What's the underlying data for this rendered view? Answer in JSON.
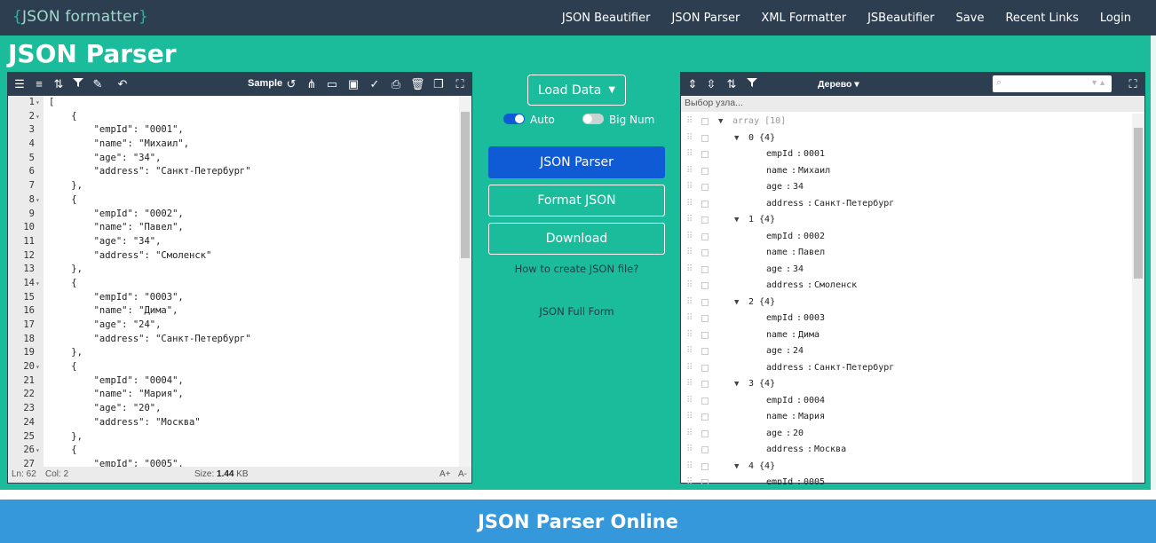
{
  "brand": {
    "open": "{",
    "name": "JSON formatter",
    "close": "}"
  },
  "nav": [
    "JSON Beautifier",
    "JSON Parser",
    "XML Formatter",
    "JSBeautifier",
    "Save",
    "Recent Links",
    "Login"
  ],
  "page_title": "JSON Parser",
  "editor": {
    "sample_label": "Sample",
    "status": {
      "line": "Ln: 62",
      "col": "Col: 2",
      "size_label": "Size:",
      "size_value": "1.44",
      "size_unit": "KB",
      "font_up": "A+",
      "font_down": "A-"
    },
    "lines": [
      {
        "n": "1",
        "fold": true,
        "text": "["
      },
      {
        "n": "2",
        "fold": true,
        "text": "    {"
      },
      {
        "n": "3",
        "text": "        \"empId\": \"0001\","
      },
      {
        "n": "4",
        "text": "        \"name\": \"Михаил\","
      },
      {
        "n": "5",
        "text": "        \"age\": \"34\","
      },
      {
        "n": "6",
        "text": "        \"address\": \"Санкт-Петербург\""
      },
      {
        "n": "7",
        "text": "    },"
      },
      {
        "n": "8",
        "fold": true,
        "text": "    {"
      },
      {
        "n": "9",
        "text": "        \"empId\": \"0002\","
      },
      {
        "n": "10",
        "text": "        \"name\": \"Павел\","
      },
      {
        "n": "11",
        "text": "        \"age\": \"34\","
      },
      {
        "n": "12",
        "text": "        \"address\": \"Смоленск\""
      },
      {
        "n": "13",
        "text": "    },"
      },
      {
        "n": "14",
        "fold": true,
        "text": "    {"
      },
      {
        "n": "15",
        "text": "        \"empId\": \"0003\","
      },
      {
        "n": "16",
        "text": "        \"name\": \"Дима\","
      },
      {
        "n": "17",
        "text": "        \"age\": \"24\","
      },
      {
        "n": "18",
        "text": "        \"address\": \"Санкт-Петербург\""
      },
      {
        "n": "19",
        "text": "    },"
      },
      {
        "n": "20",
        "fold": true,
        "text": "    {"
      },
      {
        "n": "21",
        "text": "        \"empId\": \"0004\","
      },
      {
        "n": "22",
        "text": "        \"name\": \"Мария\","
      },
      {
        "n": "23",
        "text": "        \"age\": \"20\","
      },
      {
        "n": "24",
        "text": "        \"address\": \"Москва\""
      },
      {
        "n": "25",
        "text": "    },"
      },
      {
        "n": "26",
        "fold": true,
        "text": "    {"
      },
      {
        "n": "27",
        "text": "        \"empId\": \"0005\","
      }
    ]
  },
  "middle": {
    "load_data": "Load Data",
    "auto_label": "Auto",
    "bignum_label": "Big Num",
    "parser_btn": "JSON Parser",
    "format_btn": "Format JSON",
    "download_btn": "Download",
    "link_create": "How to create JSON file?",
    "link_fullform": "JSON Full Form"
  },
  "tree": {
    "mode_label": "Дерево",
    "crumb": "Выбор узла...",
    "rows": [
      {
        "lvl": 0,
        "arrow": true,
        "text": "array [10]",
        "muted": true
      },
      {
        "lvl": 1,
        "arrow": true,
        "text": "0 {4}"
      },
      {
        "lvl": 2,
        "key": "empId",
        "val": "0001"
      },
      {
        "lvl": 2,
        "key": "name",
        "val": "Михаил"
      },
      {
        "lvl": 2,
        "key": "age",
        "val": "34"
      },
      {
        "lvl": 2,
        "key": "address",
        "val": "Санкт-Петербург"
      },
      {
        "lvl": 1,
        "arrow": true,
        "text": "1 {4}"
      },
      {
        "lvl": 2,
        "key": "empId",
        "val": "0002"
      },
      {
        "lvl": 2,
        "key": "name",
        "val": "Павел"
      },
      {
        "lvl": 2,
        "key": "age",
        "val": "34"
      },
      {
        "lvl": 2,
        "key": "address",
        "val": "Смоленск"
      },
      {
        "lvl": 1,
        "arrow": true,
        "text": "2 {4}"
      },
      {
        "lvl": 2,
        "key": "empId",
        "val": "0003"
      },
      {
        "lvl": 2,
        "key": "name",
        "val": "Дима"
      },
      {
        "lvl": 2,
        "key": "age",
        "val": "24"
      },
      {
        "lvl": 2,
        "key": "address",
        "val": "Санкт-Петербург"
      },
      {
        "lvl": 1,
        "arrow": true,
        "text": "3 {4}"
      },
      {
        "lvl": 2,
        "key": "empId",
        "val": "0004"
      },
      {
        "lvl": 2,
        "key": "name",
        "val": "Мария"
      },
      {
        "lvl": 2,
        "key": "age",
        "val": "20"
      },
      {
        "lvl": 2,
        "key": "address",
        "val": "Москва"
      },
      {
        "lvl": 1,
        "arrow": true,
        "text": "4 {4}"
      },
      {
        "lvl": 2,
        "key": "empId",
        "val": "0005"
      }
    ]
  },
  "footer": "JSON Parser Online",
  "colors": {
    "topbar": "#2d3e50",
    "teal": "#1abc9c",
    "primary": "#0f5bd6",
    "footer": "#3498db"
  }
}
